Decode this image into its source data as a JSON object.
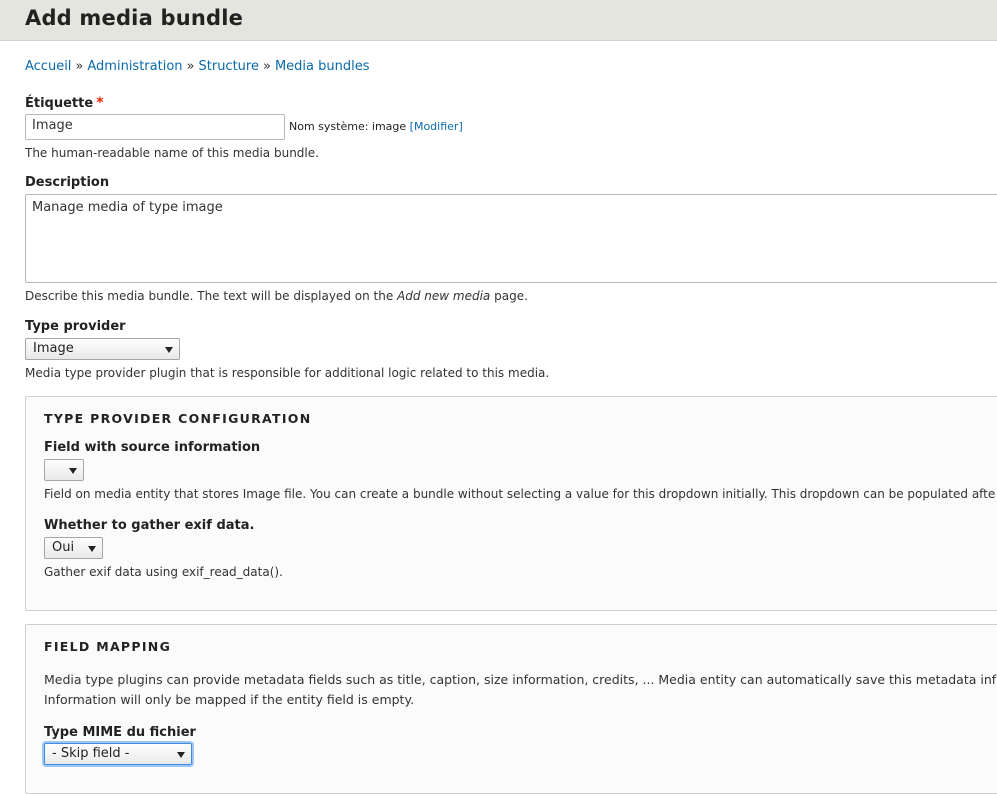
{
  "page": {
    "title": "Add media bundle"
  },
  "breadcrumb": {
    "items": [
      "Accueil",
      "Administration",
      "Structure",
      "Media bundles"
    ],
    "separator": "»"
  },
  "label_field": {
    "label": "Étiquette",
    "required_marker": "*",
    "value": "Image",
    "machine_name_prefix": "Nom système: image",
    "machine_name_edit": "[Modifier]",
    "help": "The human-readable name of this media bundle."
  },
  "description_field": {
    "label": "Description",
    "value": "Manage media of type image",
    "help_before": "Describe this media bundle. The text will be displayed on the",
    "help_em": "Add new media",
    "help_after": "page."
  },
  "type_provider": {
    "label": "Type provider",
    "selected": "Image",
    "help": "Media type provider plugin that is responsible for additional logic related to this media."
  },
  "type_provider_config": {
    "legend": "TYPE PROVIDER CONFIGURATION",
    "source_field": {
      "label": "Field with source information",
      "selected": "",
      "help": "Field on media entity that stores Image file. You can create a bundle without selecting a value for this dropdown initially. This dropdown can be populated afte"
    },
    "exif": {
      "label": "Whether to gather exif data.",
      "selected": "Oui",
      "help": "Gather exif data using exif_read_data()."
    }
  },
  "field_mapping": {
    "legend": "FIELD MAPPING",
    "intro_line1": "Media type plugins can provide metadata fields such as title, caption, size information, credits, ... Media entity can automatically save this metadata inf",
    "intro_line2": "Information will only be mapped if the entity field is empty.",
    "mime": {
      "label": "Type MIME du fichier",
      "selected": "- Skip field -"
    }
  },
  "colors": {
    "link": "#0a6aa8",
    "required": "#e32700",
    "header_bg": "#e5e5df",
    "focus": "#3d8ee0"
  }
}
